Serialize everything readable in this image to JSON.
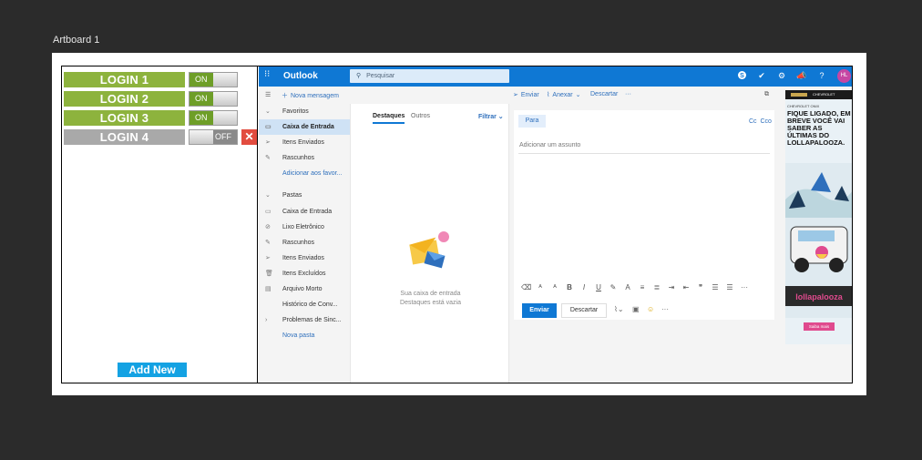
{
  "artboard": {
    "label": "Artboard 1"
  },
  "login_panel": {
    "accounts": [
      {
        "label": "LOGIN 1",
        "toggle": "ON",
        "state": "on"
      },
      {
        "label": "LOGIN 2",
        "toggle": "ON",
        "state": "on"
      },
      {
        "label": "LOGIN 3",
        "toggle": "ON",
        "state": "on"
      },
      {
        "label": "LOGIN 4",
        "toggle": "OFF",
        "state": "off"
      }
    ],
    "delete_glyph": "✕",
    "add_new_label": "Add New",
    "colors": {
      "on_button": "#8db33d",
      "off_button": "#a9a9a9",
      "add_new": "#14a2e3",
      "delete": "#e24c3f"
    }
  },
  "outlook": {
    "brand": "Outlook",
    "search_placeholder": "Pesquisar",
    "avatar_initials": "HL",
    "accent": "#0f78d4",
    "top_icons": [
      "skype-icon",
      "todo-check-icon",
      "settings-gear-icon",
      "megaphone-icon",
      "help-icon"
    ],
    "new_message": "Nova mensagem",
    "compose_commands": {
      "send": "Enviar",
      "attach": "Anexar",
      "discard": "Descartar"
    },
    "nav": {
      "favorites_heading": "Favoritos",
      "favorites": [
        {
          "label": "Caixa de Entrada",
          "icon": "inbox-icon",
          "selected": true
        },
        {
          "label": "Itens Enviados",
          "icon": "send-icon"
        },
        {
          "label": "Rascunhos",
          "icon": "pencil-icon"
        }
      ],
      "add_favorite": "Adicionar aos favor...",
      "folders_heading": "Pastas",
      "folders": [
        {
          "label": "Caixa de Entrada",
          "icon": "inbox-icon"
        },
        {
          "label": "Lixo Eletrônico",
          "icon": "junk-icon"
        },
        {
          "label": "Rascunhos",
          "icon": "pencil-icon"
        },
        {
          "label": "Itens Enviados",
          "icon": "send-icon"
        },
        {
          "label": "Itens Excluídos",
          "icon": "trash-icon"
        },
        {
          "label": "Arquivo Morto",
          "icon": "archive-icon"
        },
        {
          "label": "Histórico de Conv...",
          "icon": ""
        },
        {
          "label": "Problemas de Sinc...",
          "icon": "chevron-right-icon"
        }
      ],
      "new_folder": "Nova pasta"
    },
    "message_list": {
      "tabs": [
        "Destaques",
        "Outros"
      ],
      "filter": "Filtrar",
      "empty_line1": "Sua caixa de entrada",
      "empty_line2": "Destaques está vazia"
    },
    "compose": {
      "to_label": "Para",
      "cc_label": "Cc",
      "bcc_label": "Cco",
      "subject_placeholder": "Adicionar um assunto",
      "send_label": "Enviar",
      "discard_label": "Descartar"
    },
    "ad": {
      "header": "CHEVROLET",
      "brand_line": "CHEVROLET ONIX",
      "copy": "FIQUE LIGADO, EM BREVE VOCÊ VAI SABER AS ÚLTIMAS DO LOLLAPALOOZA.",
      "cta": "Saiba mais"
    }
  }
}
